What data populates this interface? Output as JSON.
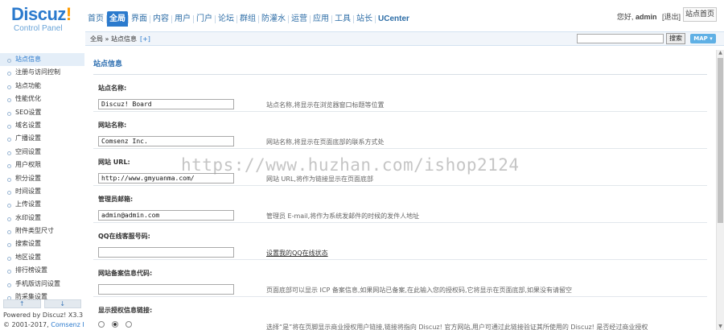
{
  "logo": {
    "brand": "Discuz",
    "bang": "!",
    "sub": "Control Panel"
  },
  "nav": [
    {
      "label": "首页",
      "active": false
    },
    {
      "label": "全局",
      "active": true
    },
    {
      "label": "界面",
      "active": false
    },
    {
      "label": "内容",
      "active": false
    },
    {
      "label": "用户",
      "active": false
    },
    {
      "label": "门户",
      "active": false
    },
    {
      "label": "论坛",
      "active": false
    },
    {
      "label": "群组",
      "active": false
    },
    {
      "label": "防灌水",
      "active": false
    },
    {
      "label": "运营",
      "active": false
    },
    {
      "label": "应用",
      "active": false
    },
    {
      "label": "工具",
      "active": false
    },
    {
      "label": "站长",
      "active": false
    },
    {
      "label": "UCenter",
      "active": false
    }
  ],
  "user": {
    "greeting": "您好,",
    "name": "admin",
    "logout": "[退出]",
    "home": "站点首页"
  },
  "subbar": {
    "crumb": "全局 » 站点信息",
    "plus": "[+]",
    "search_value": "",
    "search_btn": "搜索",
    "map_btn": "MAP ▾"
  },
  "sidebar": {
    "items": [
      {
        "label": "站点信息",
        "active": true
      },
      {
        "label": "注册与访问控制",
        "active": false
      },
      {
        "label": "站点功能",
        "active": false
      },
      {
        "label": "性能优化",
        "active": false
      },
      {
        "label": "SEO设置",
        "active": false
      },
      {
        "label": "域名设置",
        "active": false
      },
      {
        "label": "广播设置",
        "active": false
      },
      {
        "label": "空间设置",
        "active": false
      },
      {
        "label": "用户权限",
        "active": false
      },
      {
        "label": "积分设置",
        "active": false
      },
      {
        "label": "时间设置",
        "active": false
      },
      {
        "label": "上传设置",
        "active": false
      },
      {
        "label": "水印设置",
        "active": false
      },
      {
        "label": "附件类型尺寸",
        "active": false
      },
      {
        "label": "搜索设置",
        "active": false
      },
      {
        "label": "地区设置",
        "active": false
      },
      {
        "label": "排行榜设置",
        "active": false
      },
      {
        "label": "手机版访问设置",
        "active": false
      },
      {
        "label": "防采集设置",
        "active": false
      }
    ],
    "up_arrow": "↑",
    "down_arrow": "↓",
    "powered": "Powered by Discuz! X3.3",
    "copyright": "© 2001-2017,",
    "copyright_org": "Comsenz Inc."
  },
  "main": {
    "title": "站点信息",
    "fields": [
      {
        "label": "站点名称:",
        "value": "Discuz! Board",
        "desc": "站点名称,将显示在浏览器窗口标题等位置",
        "type": "text"
      },
      {
        "label": "网站名称:",
        "value": "Comsenz Inc.",
        "desc": "网站名称,将显示在页面底部的联系方式处",
        "type": "text"
      },
      {
        "label": "网站 URL:",
        "value": "http://www.gmyuanma.com/",
        "desc": "网站 URL,将作为链接显示在页面底部",
        "type": "text"
      },
      {
        "label": "管理员邮箱:",
        "value": "admin@admin.com",
        "desc": "管理员 E-mail,将作为系统发邮件的时候的发件人地址",
        "type": "text"
      },
      {
        "label": "QQ在线客服号码:",
        "value": "",
        "desc": "设置我的QQ在线状态",
        "type": "link"
      },
      {
        "label": "网站备案信息代码:",
        "value": "",
        "desc": "页面底部可以显示 ICP 备案信息,如果网站已备案,在此输入您的授权码,它将显示在页面底部,如果没有请留空",
        "type": "text"
      },
      {
        "label": "显示授权信息链接:",
        "value": "",
        "desc": "选择“是”将在页脚显示商业授权用户链接,链接将指向 Discuz! 官方网站,用户可通过此链接验证其所使用的 Discuz! 是否经过商业授权",
        "type": "radio"
      }
    ]
  },
  "watermark": "https://www.huzhan.com/ishop2124"
}
